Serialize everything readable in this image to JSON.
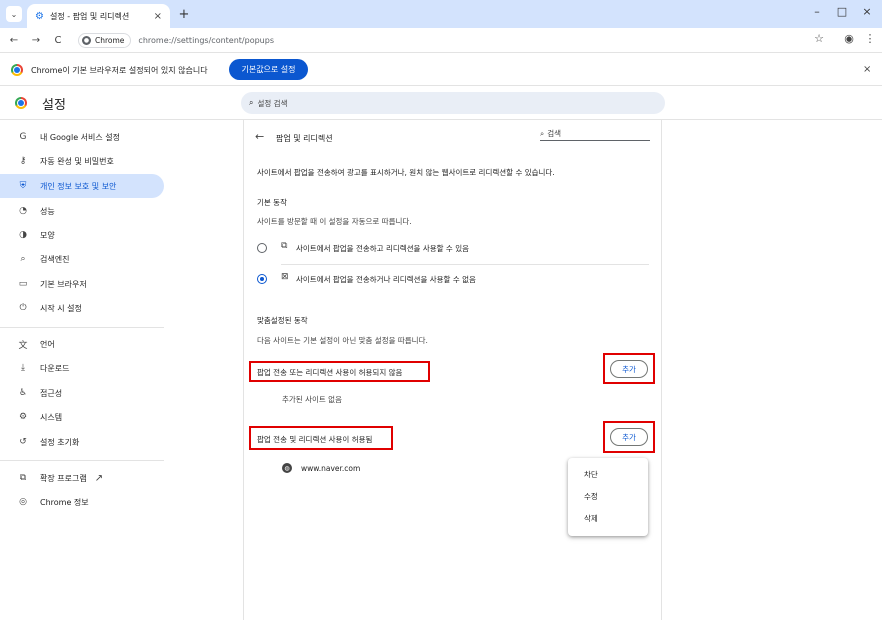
{
  "tab": {
    "title": "설정 - 팝업 및 리디렉션",
    "close": "×",
    "new_tab": "+",
    "menu": "⌄"
  },
  "window_controls": {
    "minimize": "–",
    "maximize": "□",
    "close": "×"
  },
  "toolbar": {
    "back": "←",
    "forward": "→",
    "reload": "C",
    "chip_label": "Chrome",
    "url": "chrome://settings/content/popups",
    "bookmark": "☆",
    "profile": "◉",
    "menu": "⋮"
  },
  "infobar": {
    "message": "Chrome이 기본 브라우저로 설정되어 있지 않습니다",
    "button": "기본값으로 설정",
    "close": "×"
  },
  "header": {
    "title": "설정",
    "search_placeholder": "설정 검색"
  },
  "sidebar": {
    "items": [
      {
        "icon": "G",
        "label": "내 Google 서비스 설정"
      },
      {
        "icon": "⚷",
        "label": "자동 완성 및 비밀번호"
      },
      {
        "icon": "⛨",
        "label": "개인 정보 보호 및 보안"
      },
      {
        "icon": "◔",
        "label": "성능"
      },
      {
        "icon": "◑",
        "label": "모양"
      },
      {
        "icon": "⌕",
        "label": "검색엔진"
      },
      {
        "icon": "▭",
        "label": "기본 브라우저"
      },
      {
        "icon": "⏻",
        "label": "시작 시 설정"
      },
      {
        "icon": "文",
        "label": "언어"
      },
      {
        "icon": "⤓",
        "label": "다운로드"
      },
      {
        "icon": "♿",
        "label": "접근성"
      },
      {
        "icon": "⚙",
        "label": "시스템"
      },
      {
        "icon": "↺",
        "label": "설정 초기화"
      },
      {
        "icon": "⧉",
        "label": "확장 프로그램",
        "extra": "↗"
      },
      {
        "icon": "◎",
        "label": "Chrome 정보"
      }
    ]
  },
  "main": {
    "title": "팝업 및 리디렉션",
    "search_label": "검색",
    "description": "사이트에서 팝업을 전송하여 광고를 표시하거나, 원치 않는 웹사이트로 리디렉션할 수 있습니다.",
    "default_heading": "기본 동작",
    "default_sub": "사이트를 방문할 때 이 설정을 자동으로 따릅니다.",
    "option_allow": "사이트에서 팝업을 전송하고 리디렉션을 사용할 수 있음",
    "option_block": "사이트에서 팝업을 전송하거나 리디렉션을 사용할 수 없음",
    "custom_heading": "맞춤설정된 동작",
    "custom_sub": "다음 사이트는 기본 설정이 아닌 맞춤 설정을 따릅니다.",
    "blocked_heading": "팝업 전송 또는 리디렉션 사용이 허용되지 않음",
    "add_label": "추가",
    "no_sites": "추가된 사이트 없음",
    "allowed_heading": "팝업 전송 및 리디렉션 사용이 허용됨",
    "allowed_site": "www.naver.com"
  },
  "context_menu": {
    "items": [
      "차단",
      "수정",
      "삭제"
    ]
  }
}
